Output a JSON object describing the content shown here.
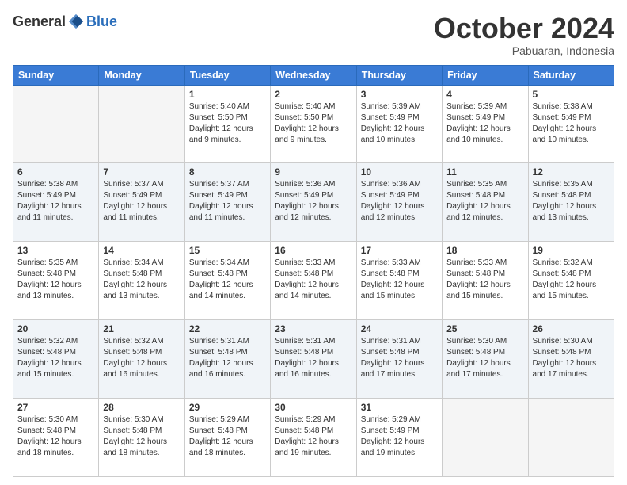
{
  "header": {
    "logo_general": "General",
    "logo_blue": "Blue",
    "month_title": "October 2024",
    "location": "Pabuaran, Indonesia"
  },
  "days_of_week": [
    "Sunday",
    "Monday",
    "Tuesday",
    "Wednesday",
    "Thursday",
    "Friday",
    "Saturday"
  ],
  "weeks": [
    [
      {
        "day": "",
        "info": ""
      },
      {
        "day": "",
        "info": ""
      },
      {
        "day": "1",
        "info": "Sunrise: 5:40 AM\nSunset: 5:50 PM\nDaylight: 12 hours and 9 minutes."
      },
      {
        "day": "2",
        "info": "Sunrise: 5:40 AM\nSunset: 5:50 PM\nDaylight: 12 hours and 9 minutes."
      },
      {
        "day": "3",
        "info": "Sunrise: 5:39 AM\nSunset: 5:49 PM\nDaylight: 12 hours and 10 minutes."
      },
      {
        "day": "4",
        "info": "Sunrise: 5:39 AM\nSunset: 5:49 PM\nDaylight: 12 hours and 10 minutes."
      },
      {
        "day": "5",
        "info": "Sunrise: 5:38 AM\nSunset: 5:49 PM\nDaylight: 12 hours and 10 minutes."
      }
    ],
    [
      {
        "day": "6",
        "info": "Sunrise: 5:38 AM\nSunset: 5:49 PM\nDaylight: 12 hours and 11 minutes."
      },
      {
        "day": "7",
        "info": "Sunrise: 5:37 AM\nSunset: 5:49 PM\nDaylight: 12 hours and 11 minutes."
      },
      {
        "day": "8",
        "info": "Sunrise: 5:37 AM\nSunset: 5:49 PM\nDaylight: 12 hours and 11 minutes."
      },
      {
        "day": "9",
        "info": "Sunrise: 5:36 AM\nSunset: 5:49 PM\nDaylight: 12 hours and 12 minutes."
      },
      {
        "day": "10",
        "info": "Sunrise: 5:36 AM\nSunset: 5:49 PM\nDaylight: 12 hours and 12 minutes."
      },
      {
        "day": "11",
        "info": "Sunrise: 5:35 AM\nSunset: 5:48 PM\nDaylight: 12 hours and 12 minutes."
      },
      {
        "day": "12",
        "info": "Sunrise: 5:35 AM\nSunset: 5:48 PM\nDaylight: 12 hours and 13 minutes."
      }
    ],
    [
      {
        "day": "13",
        "info": "Sunrise: 5:35 AM\nSunset: 5:48 PM\nDaylight: 12 hours and 13 minutes."
      },
      {
        "day": "14",
        "info": "Sunrise: 5:34 AM\nSunset: 5:48 PM\nDaylight: 12 hours and 13 minutes."
      },
      {
        "day": "15",
        "info": "Sunrise: 5:34 AM\nSunset: 5:48 PM\nDaylight: 12 hours and 14 minutes."
      },
      {
        "day": "16",
        "info": "Sunrise: 5:33 AM\nSunset: 5:48 PM\nDaylight: 12 hours and 14 minutes."
      },
      {
        "day": "17",
        "info": "Sunrise: 5:33 AM\nSunset: 5:48 PM\nDaylight: 12 hours and 15 minutes."
      },
      {
        "day": "18",
        "info": "Sunrise: 5:33 AM\nSunset: 5:48 PM\nDaylight: 12 hours and 15 minutes."
      },
      {
        "day": "19",
        "info": "Sunrise: 5:32 AM\nSunset: 5:48 PM\nDaylight: 12 hours and 15 minutes."
      }
    ],
    [
      {
        "day": "20",
        "info": "Sunrise: 5:32 AM\nSunset: 5:48 PM\nDaylight: 12 hours and 15 minutes."
      },
      {
        "day": "21",
        "info": "Sunrise: 5:32 AM\nSunset: 5:48 PM\nDaylight: 12 hours and 16 minutes."
      },
      {
        "day": "22",
        "info": "Sunrise: 5:31 AM\nSunset: 5:48 PM\nDaylight: 12 hours and 16 minutes."
      },
      {
        "day": "23",
        "info": "Sunrise: 5:31 AM\nSunset: 5:48 PM\nDaylight: 12 hours and 16 minutes."
      },
      {
        "day": "24",
        "info": "Sunrise: 5:31 AM\nSunset: 5:48 PM\nDaylight: 12 hours and 17 minutes."
      },
      {
        "day": "25",
        "info": "Sunrise: 5:30 AM\nSunset: 5:48 PM\nDaylight: 12 hours and 17 minutes."
      },
      {
        "day": "26",
        "info": "Sunrise: 5:30 AM\nSunset: 5:48 PM\nDaylight: 12 hours and 17 minutes."
      }
    ],
    [
      {
        "day": "27",
        "info": "Sunrise: 5:30 AM\nSunset: 5:48 PM\nDaylight: 12 hours and 18 minutes."
      },
      {
        "day": "28",
        "info": "Sunrise: 5:30 AM\nSunset: 5:48 PM\nDaylight: 12 hours and 18 minutes."
      },
      {
        "day": "29",
        "info": "Sunrise: 5:29 AM\nSunset: 5:48 PM\nDaylight: 12 hours and 18 minutes."
      },
      {
        "day": "30",
        "info": "Sunrise: 5:29 AM\nSunset: 5:48 PM\nDaylight: 12 hours and 19 minutes."
      },
      {
        "day": "31",
        "info": "Sunrise: 5:29 AM\nSunset: 5:49 PM\nDaylight: 12 hours and 19 minutes."
      },
      {
        "day": "",
        "info": ""
      },
      {
        "day": "",
        "info": ""
      }
    ]
  ]
}
